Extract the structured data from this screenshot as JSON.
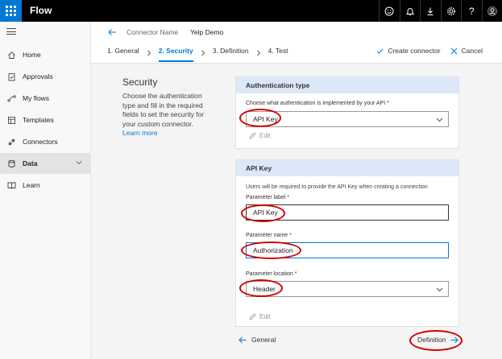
{
  "app": {
    "title": "Flow"
  },
  "topbar": {
    "icons": [
      "smiley-icon",
      "bell-icon",
      "download-icon",
      "gear-icon",
      "help-icon",
      "avatar-icon"
    ],
    "help_glyph": "?"
  },
  "sidebar": {
    "items": [
      {
        "label": "Home",
        "icon": "home-icon"
      },
      {
        "label": "Approvals",
        "icon": "approvals-icon"
      },
      {
        "label": "My flows",
        "icon": "flows-icon"
      },
      {
        "label": "Templates",
        "icon": "templates-icon"
      },
      {
        "label": "Connectors",
        "icon": "connectors-icon"
      },
      {
        "label": "Data",
        "icon": "data-icon",
        "active": true
      },
      {
        "label": "Learn",
        "icon": "learn-icon"
      }
    ]
  },
  "header": {
    "connector_name_label": "Connector Name",
    "connector_name_value": "Yelp Demo",
    "steps": [
      {
        "label": "1. General"
      },
      {
        "label": "2. Security",
        "active": true
      },
      {
        "label": "3. Definition"
      },
      {
        "label": "4. Test"
      }
    ],
    "create_label": "Create connector",
    "cancel_label": "Cancel"
  },
  "help": {
    "title": "Security",
    "text": "Choose the authentication type and fill in the required fields to set the security for your custom connector.",
    "link": "Learn more"
  },
  "auth_card": {
    "title": "Authentication type",
    "field_label": "Choose what authentication is implemented by your API",
    "required_mark": "*",
    "selected_value": "API Key",
    "edit_label": "Edit"
  },
  "apikey_card": {
    "title": "API Key",
    "note": "Users will be required to provide the API Key when creating a connection",
    "param_label_label": "Parameter label",
    "param_label_value": "API Key",
    "param_name_label": "Parameter name",
    "param_name_value": "Authorization",
    "param_location_label": "Parameter location",
    "param_location_value": "Header",
    "required_mark": "*",
    "edit_label": "Edit"
  },
  "footer": {
    "prev_label": "General",
    "next_label": "Definition"
  },
  "colors": {
    "accent": "#0078d4",
    "annotation": "#d40000",
    "card_header": "#dce8f7"
  }
}
